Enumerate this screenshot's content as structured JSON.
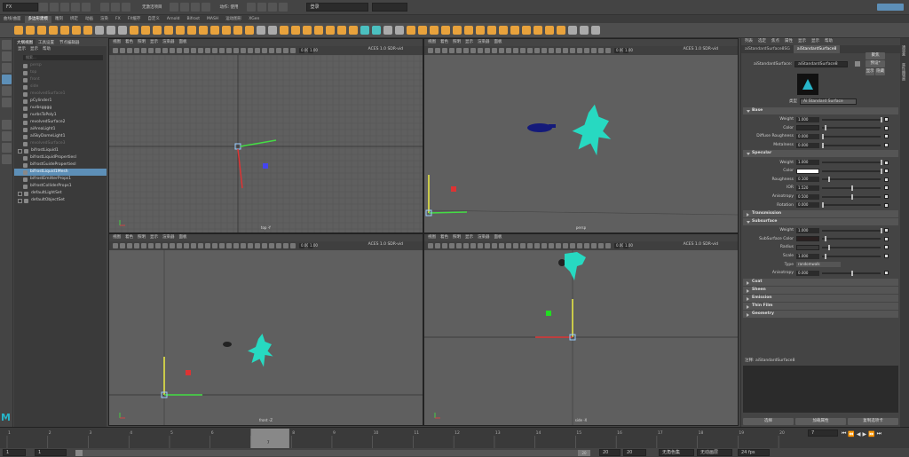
{
  "statusbar": {
    "mode": "FX",
    "select_label": "无激活项目",
    "live_label": "动作: 使用",
    "login": "登录"
  },
  "shelf_tabs": [
    "曲线/曲面",
    "多边形建模",
    "雕刻",
    "绑定",
    "动画",
    "渲染",
    "FX",
    "FX缓存",
    "自定义",
    "Arnold",
    "Bifrost",
    "MASH",
    "运动图形",
    "XGen"
  ],
  "shelf_active": 1,
  "outliner": {
    "tabs": [
      "大纲视图",
      "工具设置",
      "节点编辑器"
    ],
    "menu": [
      "显示",
      "显示",
      "帮助"
    ],
    "search_placeholder": "搜索...",
    "items": [
      {
        "label": "persp",
        "state": "dim"
      },
      {
        "label": "top",
        "state": "dim"
      },
      {
        "label": "front",
        "state": "dim"
      },
      {
        "label": "side",
        "state": "dim"
      },
      {
        "label": "revolvedSurface1",
        "state": "dim"
      },
      {
        "label": "pCylinder1",
        "state": "normal"
      },
      {
        "label": "nurbsgggg",
        "state": "normal"
      },
      {
        "label": "nurbsToPoly1",
        "state": "normal"
      },
      {
        "label": "revolvedSurface2",
        "state": "normal"
      },
      {
        "label": "aiAreaLight1",
        "state": "normal"
      },
      {
        "label": "aiSkyDomeLight1",
        "state": "normal"
      },
      {
        "label": "revolvedSurface3",
        "state": "dim"
      },
      {
        "label": "bifrostLiquid1",
        "state": "plus"
      },
      {
        "label": "bifrostLiquidPropertiesI",
        "state": "normal"
      },
      {
        "label": "bifrostGuidePropertiesI",
        "state": "normal"
      },
      {
        "label": "bifrostLiquid1Mesh",
        "state": "sel"
      },
      {
        "label": "bifrostEmitterProps1",
        "state": "normal"
      },
      {
        "label": "bifrostColliderProps1",
        "state": "normal"
      },
      {
        "label": "defaultLightSet",
        "state": "plus"
      },
      {
        "label": "defaultObjectSet",
        "state": "plus"
      }
    ]
  },
  "viewport": {
    "menu": [
      "视图",
      "着色",
      "照明",
      "显示",
      "渲染器",
      "面板"
    ],
    "aces": "ACES 1.0 SDR-vid",
    "num1": "0.00",
    "num2": "1.00",
    "labels": {
      "top": "top -Y",
      "persp": "persp",
      "front": "front -Z",
      "side": "side -X"
    }
  },
  "attribute_editor": {
    "menu": [
      "列表",
      "选定",
      "焦点",
      "属性",
      "显示",
      "显示",
      "帮助"
    ],
    "tabs": [
      "aiStandardSurface8SG",
      "aiStandardSurface8"
    ],
    "node_label": "aiStandardSurface:",
    "node_name": "aiStandardSurface8",
    "buttons": {
      "focus": "聚焦",
      "preset": "预设*",
      "show": "显示",
      "hide": "隐藏"
    },
    "type_label": "类型",
    "type_value": "Ai Standard Surface",
    "sections": {
      "base": "Base",
      "specular": "Specular",
      "transmission": "Transmission",
      "subsurface": "Subsurface",
      "coat": "Coat",
      "sheen": "Sheen",
      "emission": "Emission",
      "thin_film": "Thin Film",
      "geometry": "Geometry"
    },
    "base": {
      "weight_label": "Weight",
      "weight": "1.000",
      "color_label": "Color",
      "diffuse_label": "Diffuse Roughness",
      "diffuse": "0.000",
      "metal_label": "Metalness",
      "metal": "0.000"
    },
    "specular": {
      "weight_label": "Weight",
      "weight": "1.000",
      "color_label": "Color",
      "rough_label": "Roughness",
      "rough": "0.100",
      "ior_label": "IOR",
      "ior": "1.520",
      "aniso_label": "Anisotropy",
      "aniso": "0.500",
      "rot_label": "Rotation",
      "rot": "0.000"
    },
    "subsurface": {
      "weight_label": "Weight",
      "weight": "1.000",
      "color_label": "SubSurface Color",
      "radius_label": "Radius",
      "scale_label": "Scale",
      "scale": "1.000",
      "type_label": "Type",
      "type": "randomwalk",
      "aniso_label": "Anisotropy",
      "aniso": "0.000"
    },
    "notes_label": "注释: aiStandardSurface8",
    "bottom_buttons": [
      "选择",
      "加载属性",
      "复制选项卡"
    ]
  },
  "timeline": {
    "ticks": [
      "1",
      "2",
      "3",
      "4",
      "5",
      "6",
      "7",
      "8",
      "9",
      "10",
      "11",
      "12",
      "13",
      "14",
      "15",
      "16",
      "17",
      "18",
      "19",
      "20"
    ],
    "current": "7",
    "frame_field": "7"
  },
  "range": {
    "start": "1",
    "start2": "1",
    "end": "20",
    "end2": "20",
    "end3": "20",
    "fps": "24 fps",
    "char_label": "无角色集",
    "layer_label": "无动画层"
  },
  "colors": {
    "accent": "#5d8fb7",
    "liquid": "#27d9c1",
    "bottle": "#141a7a"
  }
}
